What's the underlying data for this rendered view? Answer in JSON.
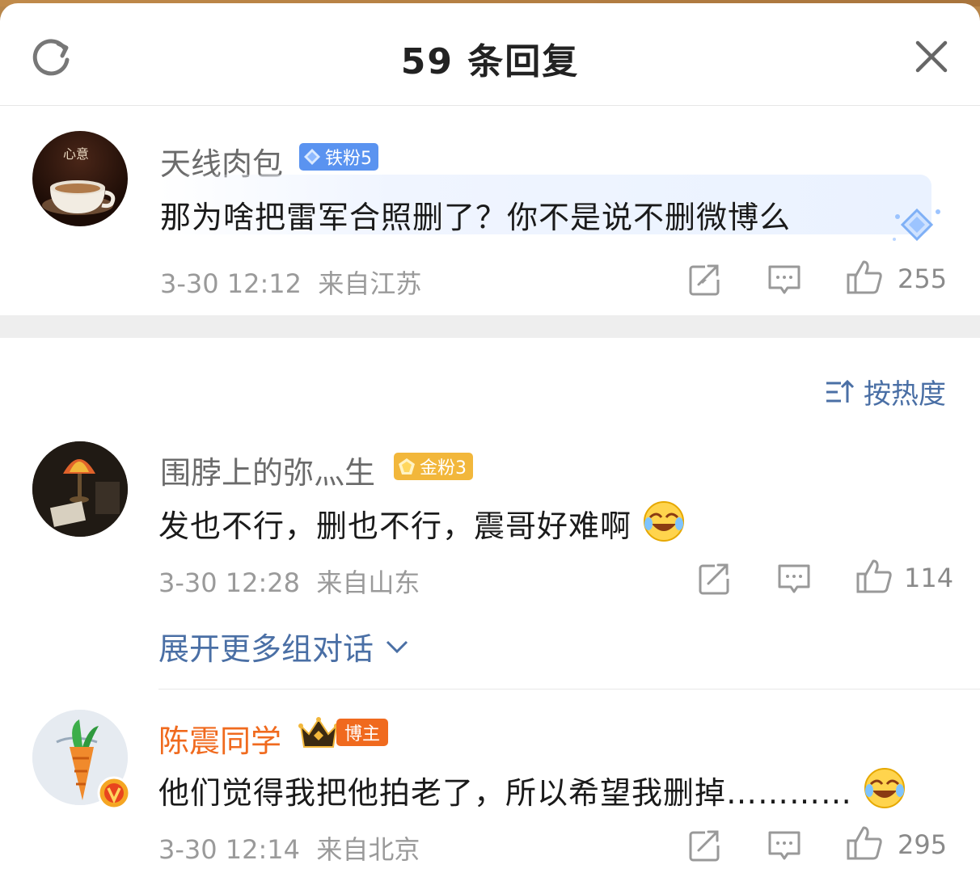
{
  "header": {
    "title": "59 条回复"
  },
  "main_comment": {
    "user": "天线肉包",
    "badge": "铁粉5",
    "text": "那为啥把雷军合照删了？你不是说不删微博么",
    "time": "3-30 12:12",
    "location": "来自江苏",
    "likes": "255",
    "avatar_text": "心意"
  },
  "sort": {
    "label": "按热度"
  },
  "replies": [
    {
      "user": "围脖上的弥灬生",
      "badge": "金粉3",
      "text": "发也不行，删也不行，震哥好难啊",
      "time": "3-30 12:28",
      "location": "来自山东",
      "likes": "114"
    },
    {
      "user": "陈震同学",
      "badge": "博主",
      "text": "他们觉得我把他拍老了，所以希望我删掉…………",
      "time": "3-30 12:14",
      "location": "来自北京",
      "likes": "295"
    }
  ],
  "expand": {
    "label": "展开更多组对话"
  },
  "colors": {
    "link_blue": "#4a6fa5",
    "iron_badge": "#5a93f0",
    "gold_badge": "#f2b73b",
    "author_orange": "#f06a1e"
  }
}
